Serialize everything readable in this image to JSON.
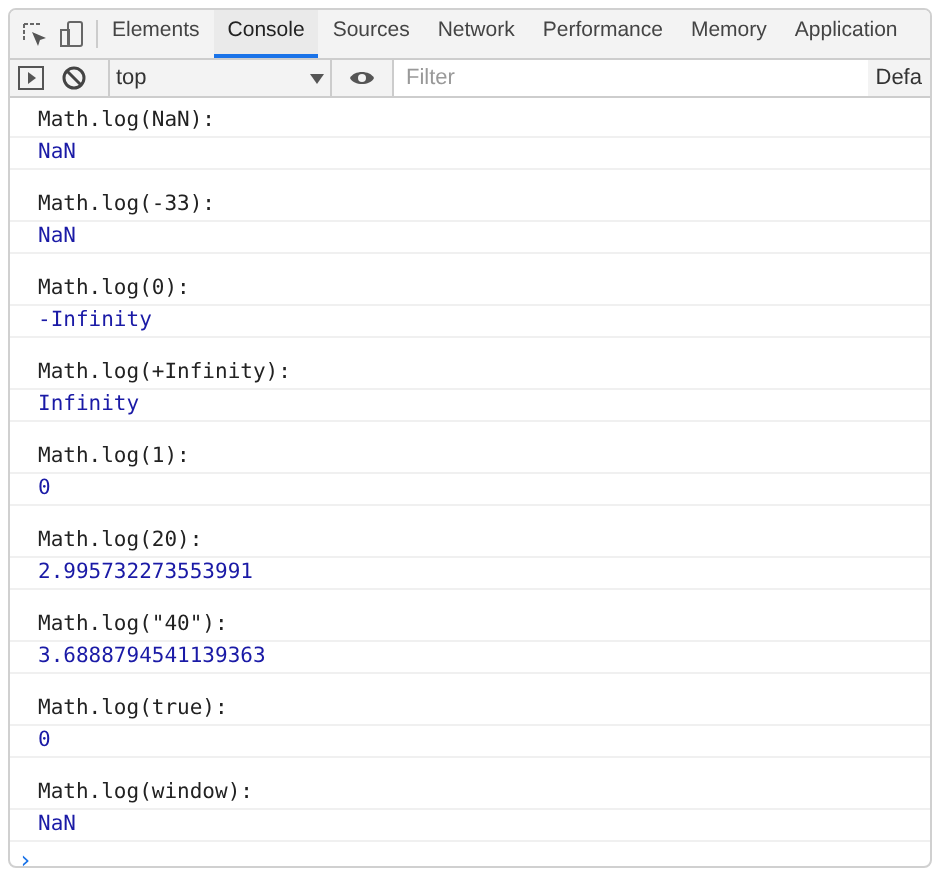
{
  "tabs": [
    {
      "label": "Elements",
      "selected": false
    },
    {
      "label": "Console",
      "selected": true
    },
    {
      "label": "Sources",
      "selected": false
    },
    {
      "label": "Network",
      "selected": false
    },
    {
      "label": "Performance",
      "selected": false
    },
    {
      "label": "Memory",
      "selected": false
    },
    {
      "label": "Application",
      "selected": false
    }
  ],
  "toolbar": {
    "context": "top",
    "filter_placeholder": "Filter",
    "levels": "Defa"
  },
  "entries": [
    {
      "label": "Math.log(NaN):",
      "value": "NaN"
    },
    {
      "label": "Math.log(-33):",
      "value": "NaN"
    },
    {
      "label": "Math.log(0):",
      "value": "-Infinity"
    },
    {
      "label": "Math.log(+Infinity):",
      "value": "Infinity"
    },
    {
      "label": "Math.log(1):",
      "value": "0"
    },
    {
      "label": "Math.log(20):",
      "value": "2.995732273553991"
    },
    {
      "label": "Math.log(\"40\"):",
      "value": "3.6888794541139363"
    },
    {
      "label": "Math.log(true):",
      "value": "0"
    },
    {
      "label": "Math.log(window):",
      "value": "NaN"
    }
  ],
  "prompt": "›"
}
